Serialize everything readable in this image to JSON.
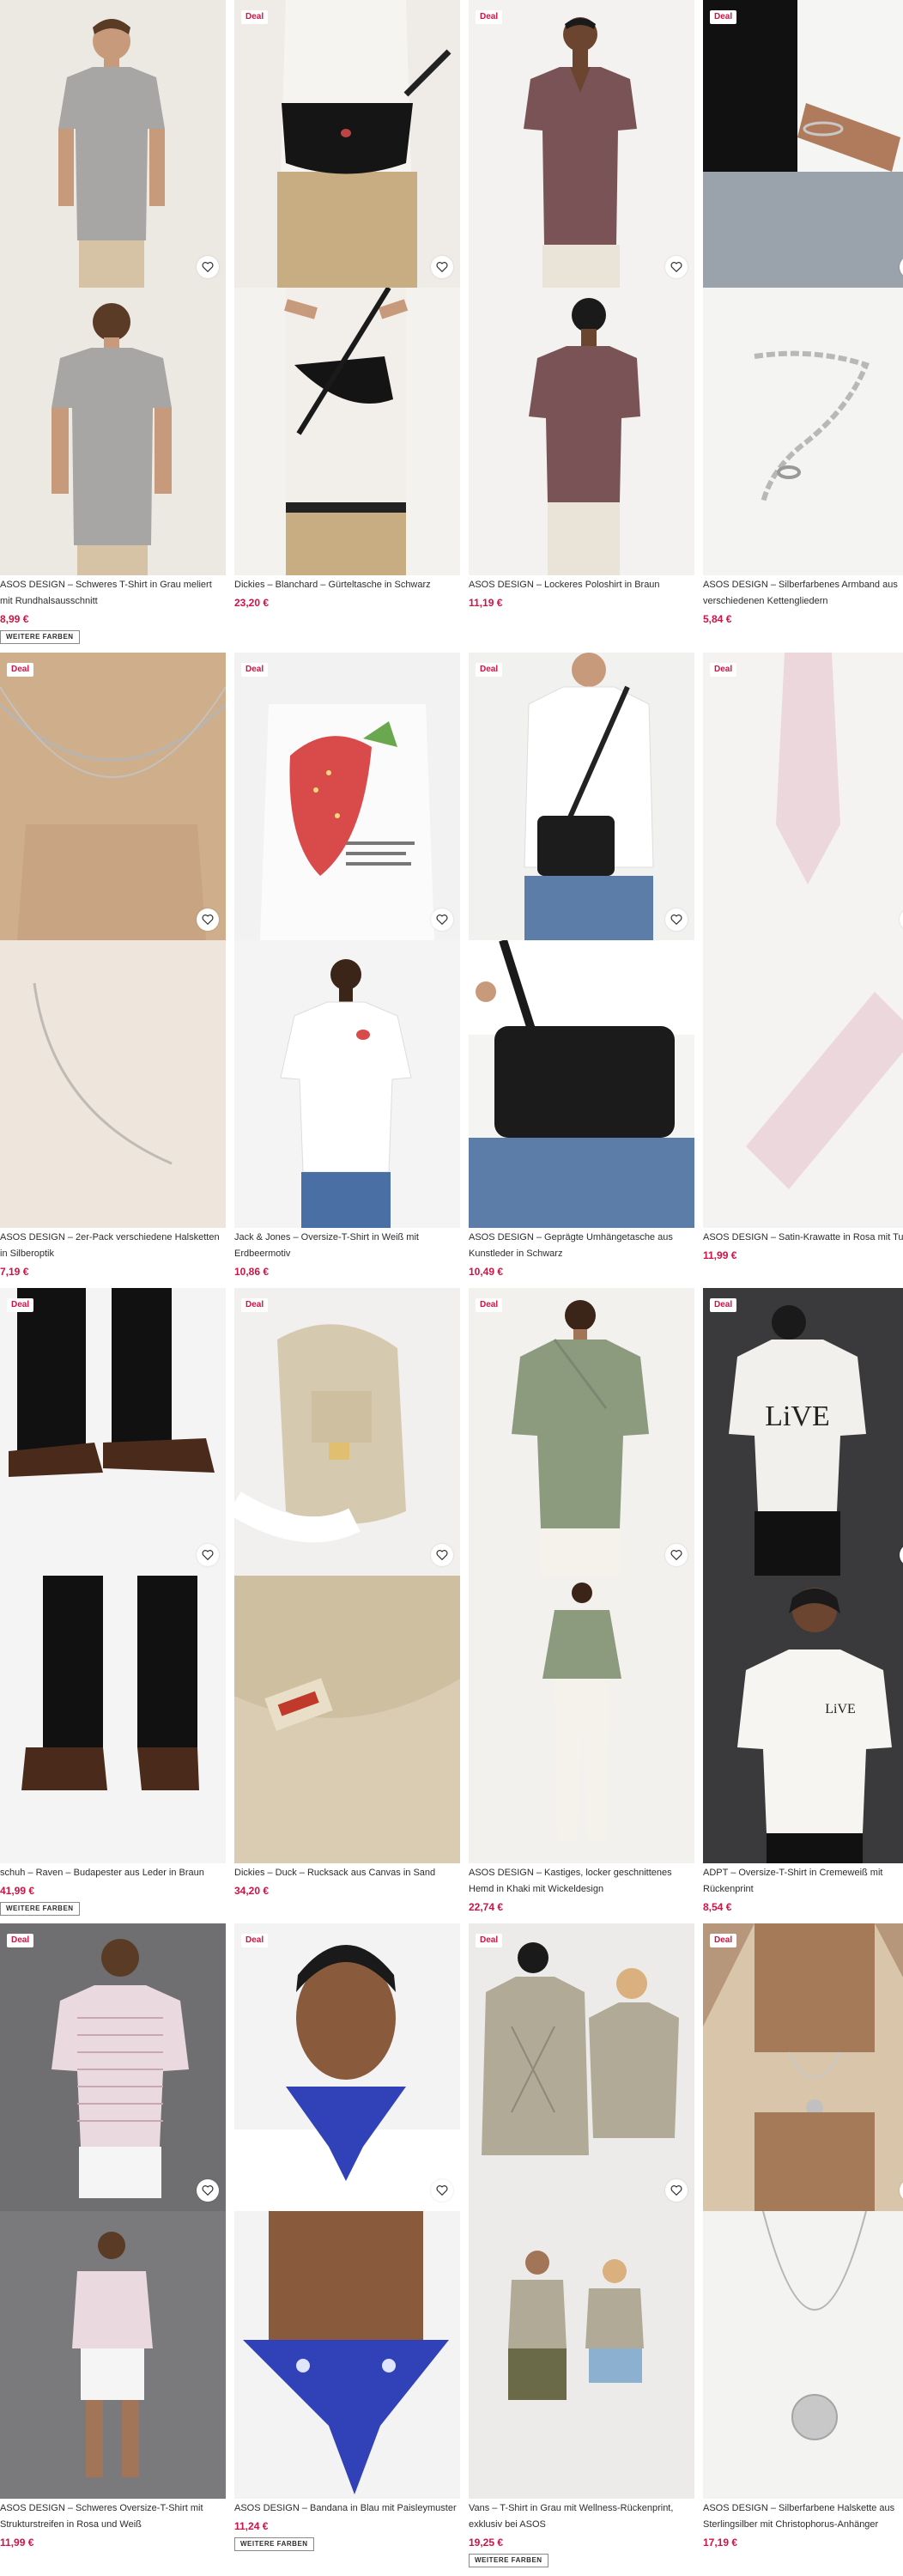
{
  "labels": {
    "deal": "Deal",
    "more_colors": "WEITERE FARBEN"
  },
  "colors": {
    "price": "#d01345",
    "deal_text": "#d01345"
  },
  "products": [
    {
      "title": "ASOS DESIGN – Schweres T-Shirt in Grau meliert mit Rundhalsausschnitt",
      "price": "8,99 €",
      "deal": false,
      "more_colors": true,
      "image_top": "man-grey-tshirt-front",
      "image_bottom": "man-grey-tshirt-back"
    },
    {
      "title": "Dickies – Blanchard – Gürteltasche in Schwarz",
      "price": "23,20 €",
      "deal": true,
      "more_colors": false,
      "image_top": "black-belt-bag",
      "image_bottom": "black-belt-bag-worn"
    },
    {
      "title": "ASOS DESIGN – Lockeres Poloshirt in Braun",
      "price": "11,19 €",
      "deal": true,
      "more_colors": false,
      "image_top": "man-brown-polo-front",
      "image_bottom": "man-brown-polo-back"
    },
    {
      "title": "ASOS DESIGN – Silberfarbenes Armband aus verschiedenen Kettengliedern",
      "price": "5,84 €",
      "deal": true,
      "more_colors": false,
      "image_top": "silver-bracelet-worn",
      "image_bottom": "silver-bracelet"
    },
    {
      "title": "ASOS DESIGN – 2er-Pack verschiedene Halsketten in Silberoptik",
      "price": "7,19 €",
      "deal": true,
      "more_colors": false,
      "image_top": "silver-necklaces-worn",
      "image_bottom": "silver-necklace"
    },
    {
      "title": "Jack & Jones – Oversize-T-Shirt in Weiß mit Erdbeermotiv",
      "price": "10,86 €",
      "deal": true,
      "more_colors": false,
      "image_top": "white-tshirt-strawberry-back",
      "image_bottom": "man-white-tshirt-front"
    },
    {
      "title": "ASOS DESIGN – Geprägte Umhängetasche aus Kunstleder in Schwarz",
      "price": "10,49 €",
      "deal": true,
      "more_colors": false,
      "image_top": "man-crossbody-bag",
      "image_bottom": "black-crossbody-bag"
    },
    {
      "title": "ASOS DESIGN – Satin-Krawatte in Rosa mit Tupfen",
      "price": "11,99 €",
      "deal": true,
      "more_colors": false,
      "image_top": "pink-tie",
      "image_bottom": "pink-tie-detail"
    },
    {
      "title": "schuh – Raven – Budapester aus Leder in Braun",
      "price": "41,99 €",
      "deal": true,
      "more_colors": true,
      "image_top": "brown-leather-shoes-side",
      "image_bottom": "brown-leather-shoes-front"
    },
    {
      "title": "Dickies – Duck – Rucksack aus Canvas in Sand",
      "price": "34,20 €",
      "deal": true,
      "more_colors": false,
      "image_top": "sand-backpack",
      "image_bottom": "sand-canvas-detail"
    },
    {
      "title": "ASOS DESIGN – Kastiges, locker geschnittenes Hemd in Khaki mit Wickeldesign",
      "price": "22,74 €",
      "deal": true,
      "more_colors": false,
      "image_top": "man-khaki-shirt",
      "image_bottom": "man-khaki-shirt-full"
    },
    {
      "title": "ADPT – Oversize-T-Shirt in Cremeweiß mit Rückenprint",
      "price": "8,54 €",
      "deal": true,
      "more_colors": false,
      "image_top": "man-live-tshirt-back",
      "image_bottom": "man-live-tshirt-front"
    },
    {
      "title": "ASOS DESIGN – Schweres Oversize-T-Shirt mit Strukturstreifen in Rosa und Weiß",
      "price": "11,99 €",
      "deal": true,
      "more_colors": false,
      "image_top": "man-striped-tshirt",
      "image_bottom": "man-striped-tshirt-full"
    },
    {
      "title": "ASOS DESIGN – Bandana in Blau mit Paisleymuster",
      "price": "11,24 €",
      "deal": true,
      "more_colors": true,
      "image_top": "man-blue-bandana",
      "image_bottom": "blue-bandana-closeup"
    },
    {
      "title": "Vans – T-Shirt in Grau mit Wellness-Rückenprint, exklusiv bei ASOS",
      "price": "19,25 €",
      "deal": true,
      "more_colors": true,
      "image_top": "couple-grey-tshirt-back",
      "image_bottom": "couple-grey-tshirt-front"
    },
    {
      "title": "ASOS DESIGN – Silberfarbene Halskette aus Sterlingsilber mit Christophorus-Anhänger",
      "price": "17,19 €",
      "deal": true,
      "more_colors": false,
      "image_top": "man-pendant-necklace",
      "image_bottom": "silver-pendant-necklace"
    }
  ]
}
